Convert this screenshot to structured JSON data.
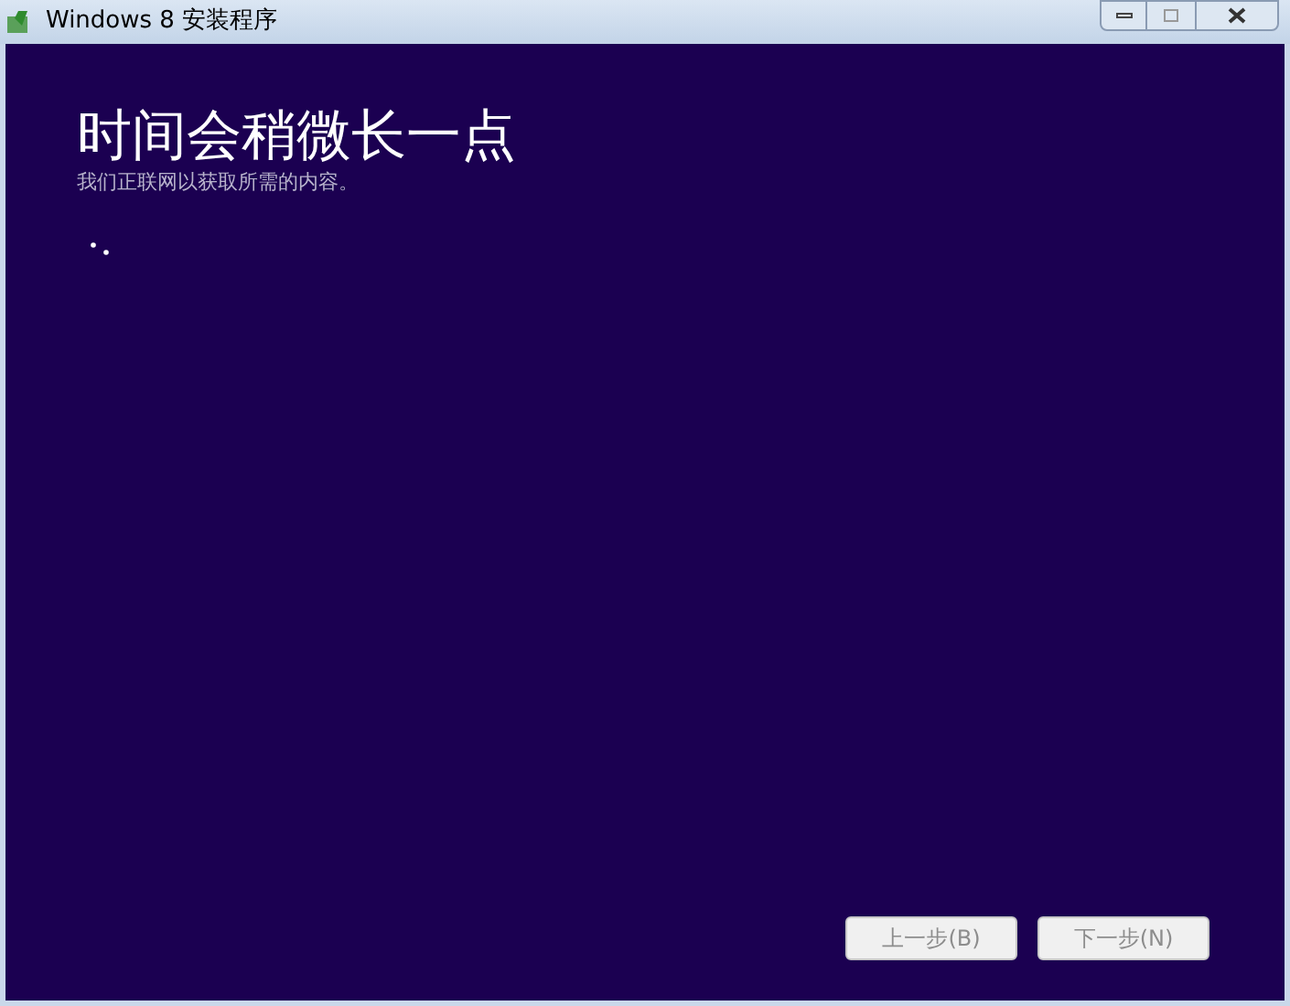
{
  "window": {
    "title": "Windows 8 安装程序"
  },
  "heading": "时间会稍微长一点",
  "subtitle": "我们正联网以获取所需的内容。",
  "buttons": [
    {
      "label": "上一步(B)",
      "disabled": true
    },
    {
      "label": "下一步(N)",
      "disabled": true
    }
  ]
}
